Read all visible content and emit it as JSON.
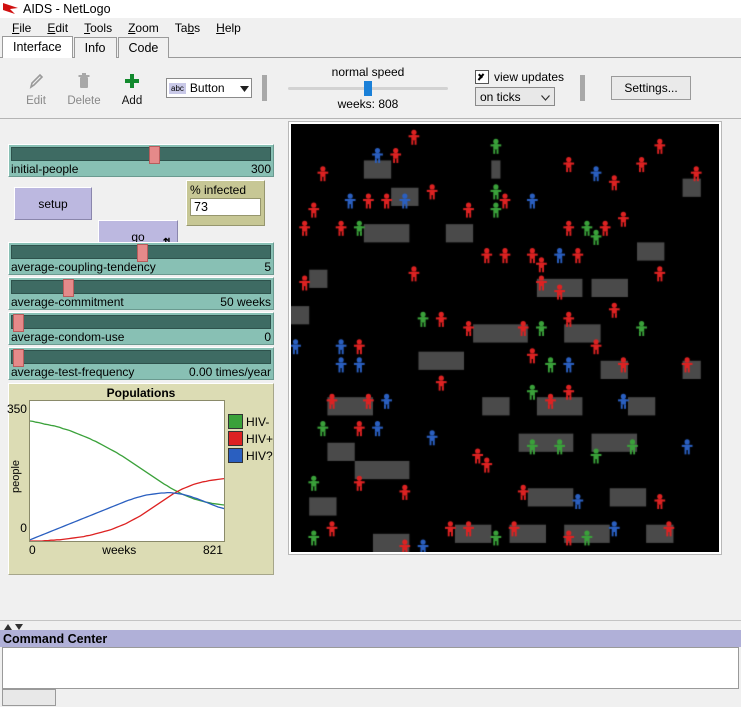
{
  "window": {
    "title": "AIDS - NetLogo",
    "logo_icon": "netlogo-arrow-logo"
  },
  "menu": [
    {
      "label": "File",
      "mnemonic": "F"
    },
    {
      "label": "Edit",
      "mnemonic": "E"
    },
    {
      "label": "Tools",
      "mnemonic": "T"
    },
    {
      "label": "Zoom",
      "mnemonic": "Z"
    },
    {
      "label": "Tabs",
      "mnemonic": "b"
    },
    {
      "label": "Help",
      "mnemonic": "H"
    }
  ],
  "tabs": [
    {
      "label": "Interface",
      "selected": true
    },
    {
      "label": "Info",
      "selected": false
    },
    {
      "label": "Code",
      "selected": false
    }
  ],
  "toolbar": {
    "edit_label": "Edit",
    "edit_icon": "pencil-icon",
    "delete_label": "Delete",
    "delete_icon": "trash-icon",
    "add_label": "Add",
    "add_icon": "plus-icon",
    "widget_type": "Button",
    "widget_type_icon": "abc-button-icon",
    "widget_chevron_icon": "chevron-down-icon",
    "speed_label": "normal speed",
    "tick_counter": "weeks: 808",
    "view_updates_label": "view updates",
    "view_updates_checked": true,
    "view_updates_icon": "checkbox-checked-icon",
    "update_mode": "on ticks",
    "update_mode_chevron_icon": "chevron-down-icon",
    "settings_label": "Settings..."
  },
  "sliders": [
    {
      "name": "initial-people",
      "value": "300",
      "fill": 0.55
    },
    {
      "name": "average-coupling-tendency",
      "value": "5",
      "fill": 0.5
    },
    {
      "name": "average-commitment",
      "value": "50 weeks",
      "fill": 0.205
    },
    {
      "name": "average-condom-use",
      "value": "0",
      "fill": 0.005
    },
    {
      "name": "average-test-frequency",
      "value": "0.00 times/year",
      "fill": 0.005
    }
  ],
  "buttons": [
    {
      "label": "setup",
      "forever": false
    },
    {
      "label": "go",
      "forever": true,
      "forever_icon": "loop-arrows-icon"
    }
  ],
  "monitor": {
    "title": "% infected",
    "value": "73"
  },
  "command_center": {
    "title": "Command Center",
    "collapse_up_icon": "triangle-up-icon",
    "collapse_down_icon": "triangle-down-icon",
    "output": "",
    "input": ""
  },
  "world": {
    "background": "#000000",
    "patch_color": "#4a4a4a",
    "agent_colors": {
      "hiv_negative": "#3aa13a",
      "hiv_positive": "#dd2222",
      "hiv_unknown": "#2a5fc0"
    },
    "patches": [
      [
        8,
        4,
        3,
        2
      ],
      [
        22,
        4,
        1,
        2
      ],
      [
        8,
        11,
        5,
        2
      ],
      [
        2,
        16,
        2,
        2
      ],
      [
        27,
        17,
        5,
        2
      ],
      [
        33,
        17,
        4,
        2
      ],
      [
        20,
        22,
        6,
        2
      ],
      [
        30,
        22,
        4,
        2
      ],
      [
        34,
        26,
        3,
        2
      ],
      [
        14,
        25,
        5,
        2
      ],
      [
        4,
        30,
        5,
        2
      ],
      [
        27,
        30,
        5,
        2
      ],
      [
        37,
        30,
        3,
        2
      ],
      [
        4,
        35,
        3,
        2
      ],
      [
        7,
        37,
        6,
        2
      ],
      [
        25,
        34,
        6,
        2
      ],
      [
        33,
        34,
        5,
        2
      ],
      [
        2,
        41,
        3,
        2
      ],
      [
        9,
        45,
        4,
        2
      ],
      [
        26,
        40,
        5,
        2
      ],
      [
        35,
        40,
        4,
        2
      ],
      [
        18,
        44,
        4,
        2
      ],
      [
        24,
        44,
        4,
        2
      ],
      [
        30,
        44,
        5,
        2
      ],
      [
        39,
        44,
        3,
        2
      ],
      [
        0,
        20,
        2,
        2
      ],
      [
        43,
        6,
        2,
        2
      ],
      [
        43,
        26,
        2,
        2
      ],
      [
        11,
        7,
        3,
        2
      ],
      [
        17,
        11,
        3,
        2
      ],
      [
        21,
        30,
        3,
        2
      ],
      [
        38,
        13,
        3,
        2
      ]
    ],
    "agents": [
      [
        3,
        5,
        "r"
      ],
      [
        9,
        3,
        "b"
      ],
      [
        11,
        3,
        "r"
      ],
      [
        13,
        1,
        "r"
      ],
      [
        22,
        2,
        "g"
      ],
      [
        30,
        4,
        "r"
      ],
      [
        33,
        5,
        "b"
      ],
      [
        35,
        6,
        "r"
      ],
      [
        38,
        4,
        "r"
      ],
      [
        40,
        2,
        "r"
      ],
      [
        2,
        9,
        "r"
      ],
      [
        6,
        8,
        "b"
      ],
      [
        8,
        8,
        "r"
      ],
      [
        10,
        8,
        "r"
      ],
      [
        12,
        8,
        "b"
      ],
      [
        15,
        7,
        "r"
      ],
      [
        22,
        7,
        "g"
      ],
      [
        23,
        8,
        "r"
      ],
      [
        22,
        9,
        "g"
      ],
      [
        26,
        8,
        "b"
      ],
      [
        30,
        11,
        "r"
      ],
      [
        32,
        11,
        "g"
      ],
      [
        34,
        11,
        "r"
      ],
      [
        36,
        10,
        "r"
      ],
      [
        44,
        5,
        "r"
      ],
      [
        1,
        11,
        "r"
      ],
      [
        5,
        11,
        "r"
      ],
      [
        7,
        11,
        "g"
      ],
      [
        21,
        14,
        "r"
      ],
      [
        23,
        14,
        "r"
      ],
      [
        26,
        14,
        "r"
      ],
      [
        27,
        15,
        "r"
      ],
      [
        29,
        14,
        "b"
      ],
      [
        31,
        14,
        "r"
      ],
      [
        33,
        12,
        "g"
      ],
      [
        1,
        17,
        "r"
      ],
      [
        27,
        17,
        "r"
      ],
      [
        29,
        18,
        "r"
      ],
      [
        25,
        22,
        "r"
      ],
      [
        27,
        22,
        "g"
      ],
      [
        30,
        21,
        "r"
      ],
      [
        14,
        21,
        "g"
      ],
      [
        16,
        21,
        "r"
      ],
      [
        19,
        22,
        "r"
      ],
      [
        0,
        24,
        "b"
      ],
      [
        5,
        24,
        "b"
      ],
      [
        7,
        24,
        "r"
      ],
      [
        33,
        24,
        "r"
      ],
      [
        38,
        22,
        "g"
      ],
      [
        43,
        26,
        "r"
      ],
      [
        5,
        26,
        "b"
      ],
      [
        7,
        26,
        "b"
      ],
      [
        26,
        25,
        "r"
      ],
      [
        28,
        26,
        "g"
      ],
      [
        30,
        26,
        "b"
      ],
      [
        36,
        26,
        "r"
      ],
      [
        4,
        30,
        "r"
      ],
      [
        8,
        30,
        "r"
      ],
      [
        10,
        30,
        "b"
      ],
      [
        26,
        29,
        "g"
      ],
      [
        28,
        30,
        "r"
      ],
      [
        30,
        29,
        "r"
      ],
      [
        36,
        30,
        "b"
      ],
      [
        3,
        33,
        "g"
      ],
      [
        7,
        33,
        "r"
      ],
      [
        9,
        33,
        "b"
      ],
      [
        15,
        34,
        "b"
      ],
      [
        20,
        36,
        "r"
      ],
      [
        21,
        37,
        "r"
      ],
      [
        26,
        35,
        "g"
      ],
      [
        29,
        35,
        "g"
      ],
      [
        33,
        36,
        "g"
      ],
      [
        37,
        35,
        "g"
      ],
      [
        2,
        39,
        "g"
      ],
      [
        7,
        39,
        "r"
      ],
      [
        12,
        40,
        "r"
      ],
      [
        25,
        40,
        "r"
      ],
      [
        31,
        41,
        "b"
      ],
      [
        40,
        41,
        "r"
      ],
      [
        17,
        44,
        "r"
      ],
      [
        19,
        44,
        "r"
      ],
      [
        22,
        45,
        "g"
      ],
      [
        24,
        44,
        "r"
      ],
      [
        30,
        45,
        "r"
      ],
      [
        32,
        45,
        "g"
      ],
      [
        41,
        44,
        "r"
      ],
      [
        12,
        46,
        "r"
      ],
      [
        14,
        46,
        "b"
      ],
      [
        4,
        44,
        "r"
      ],
      [
        35,
        20,
        "r"
      ],
      [
        16,
        28,
        "r"
      ],
      [
        40,
        16,
        "r"
      ],
      [
        43,
        35,
        "b"
      ],
      [
        13,
        16,
        "r"
      ],
      [
        19,
        9,
        "r"
      ],
      [
        35,
        44,
        "b"
      ],
      [
        2,
        45,
        "g"
      ]
    ]
  },
  "chart_data": {
    "type": "line",
    "title": "Populations",
    "xlabel": "weeks",
    "ylabel": "people",
    "xlim": [
      0,
      821
    ],
    "ylim": [
      0,
      350
    ],
    "xticks": [
      "0",
      "821"
    ],
    "yticks": [
      "0",
      "350"
    ],
    "grid": false,
    "legend_position": "right",
    "series": [
      {
        "name": "HIV-",
        "color": "#3aa13a",
        "values": [
          300,
          299,
          297,
          296,
          294,
          292,
          291,
          289,
          288,
          286,
          284,
          281,
          279,
          277,
          274,
          271,
          268,
          265,
          262,
          259,
          256,
          252,
          249,
          245,
          241,
          237,
          233,
          229,
          225,
          221,
          216,
          212,
          207,
          202,
          197,
          192,
          187,
          182,
          177,
          172,
          167,
          162,
          157,
          152,
          147,
          142,
          138,
          133,
          129,
          125,
          121,
          117,
          114,
          111,
          108,
          105,
          103,
          101,
          99,
          97,
          96,
          94,
          93,
          92,
          91,
          90
        ]
      },
      {
        "name": "HIV+",
        "color": "#dd2222",
        "values": [
          0,
          0,
          0,
          0,
          0,
          1,
          1,
          2,
          2,
          3,
          3,
          4,
          5,
          6,
          7,
          8,
          9,
          10,
          11,
          13,
          14,
          16,
          18,
          20,
          22,
          24,
          26,
          28,
          31,
          34,
          37,
          40,
          43,
          47,
          51,
          55,
          59,
          63,
          68,
          73,
          78,
          83,
          88,
          93,
          98,
          103,
          108,
          113,
          118,
          122,
          126,
          130,
          133,
          136,
          139,
          142,
          144,
          146,
          148,
          149,
          151,
          152,
          153,
          154,
          155,
          156
        ]
      },
      {
        "name": "HIV?",
        "color": "#2a5fc0",
        "values": [
          3,
          6,
          9,
          12,
          15,
          18,
          21,
          24,
          27,
          30,
          33,
          36,
          39,
          42,
          45,
          48,
          51,
          54,
          57,
          60,
          63,
          66,
          69,
          72,
          75,
          78,
          81,
          84,
          87,
          90,
          93,
          96,
          99,
          102,
          104,
          107,
          109,
          111,
          113,
          115,
          116,
          117,
          118,
          119,
          120,
          120,
          121,
          121,
          120,
          119,
          118,
          117,
          115,
          113,
          111,
          108,
          106,
          103,
          100,
          97,
          94,
          91,
          88,
          85,
          83,
          81
        ]
      }
    ]
  }
}
